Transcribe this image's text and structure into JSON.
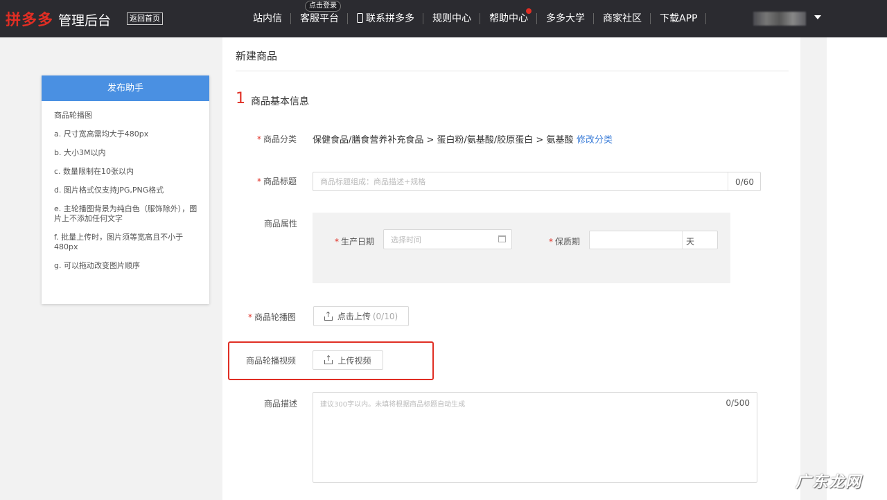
{
  "topbar": {
    "logo": "拼多多",
    "subtitle": "管理后台",
    "back_home": "返回首页",
    "login_badge": "点击登录",
    "nav": [
      "站内信",
      "客服平台",
      "联系拼多多",
      "规则中心",
      "帮助中心",
      "多多大学",
      "商家社区",
      "下载APP"
    ]
  },
  "helper": {
    "title": "发布助手",
    "items": [
      "商品轮播图",
      "a. 尺寸宽高需均大于480px",
      "b. 大小3M以内",
      "c. 数量限制在10张以内",
      "d. 图片格式仅支持JPG,PNG格式",
      "e. 主轮播图背景为纯白色（服饰除外），图片上不添加任何文字",
      "f. 批量上传时，图片须等宽高且不小于480px",
      "g. 可以拖动改变图片顺序"
    ]
  },
  "form": {
    "page_title": "新建商品",
    "step_num": "1",
    "step_label": "商品基本信息",
    "category_label": "商品分类",
    "category_value": "保健食品/膳食营养补充食品 > 蛋白粉/氨基酸/胶原蛋白 > 氨基酸",
    "category_edit": "修改分类",
    "title_label": "商品标题",
    "title_placeholder": "商品标题组成：商品描述+规格",
    "title_count": "0/60",
    "attr_label": "商品属性",
    "prod_date_label": "生产日期",
    "prod_date_placeholder": "选择时间",
    "shelf_label": "保质期",
    "shelf_unit": "天",
    "carousel_label": "商品轮播图",
    "carousel_btn": "点击上传",
    "carousel_count": "(0/10)",
    "video_label": "商品轮播视频",
    "video_btn": "上传视频",
    "desc_label": "商品描述",
    "desc_placeholder": "建议300字以内。未填将根据商品标题自动生成",
    "desc_count": "0/500"
  },
  "watermark": "广东龙网"
}
